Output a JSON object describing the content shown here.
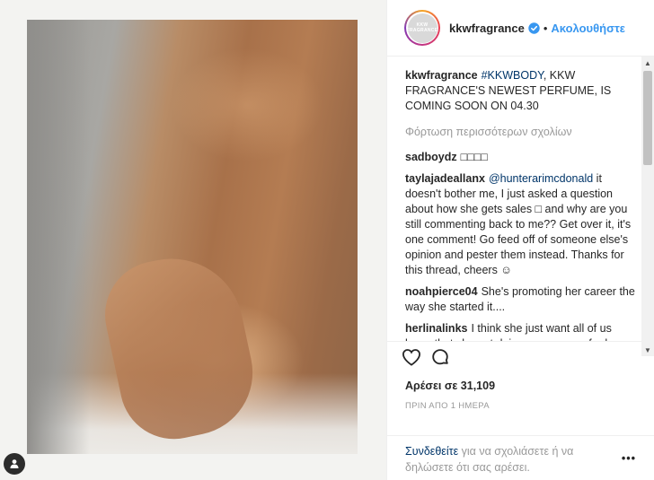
{
  "header": {
    "avatar_text": "KKW FRAGRANCE",
    "username": "kkwfragrance",
    "separator": "•",
    "follow_label": "Ακολουθήστε"
  },
  "caption": {
    "user": "kkwfragrance",
    "hashtag": "#KKWBODY",
    "text": ", KKW FRAGRANCE'S NEWEST PERFUME, IS COMING SOON ON 04.30"
  },
  "load_more": "Φόρτωση περισσότερων σχολίων",
  "comments": [
    {
      "user": "sadboydz",
      "pre": "",
      "mention": "",
      "text": "□□□□"
    },
    {
      "user": "taylajadeallanx",
      "pre": "",
      "mention": "@hunterarimcdonald",
      "text": " it doesn't bother me, I just asked a question about how she gets sales □ and why are you still commenting back to me?? Get over it, it's one comment! Go feed off of someone else's opinion and pester them instead. Thanks for this thread, cheers ☺"
    },
    {
      "user": "noahpierce04",
      "pre": "",
      "mention": "",
      "text": "She's promoting her career the way she started it...."
    },
    {
      "user": "herlinalinks",
      "pre": "",
      "mention": "",
      "text": "I think she just want all of us know that she not doing any surgery for her breast? Then what the poin this with the fragrance?"
    }
  ],
  "likes": "Αρέσει σε 31,109",
  "time": "ΠΡΙΝ ΑΠΟ 1 ΗΜΕΡΑ",
  "login": {
    "link": "Συνδεθείτε",
    "text": " για να σχολιάσετε ή να δηλώσετε ότι σας αρέσει."
  },
  "more_label": "•••",
  "icons": {
    "verified": "verified-badge-icon",
    "heart": "heart-icon",
    "comment": "comment-bubble-icon",
    "user_tag": "user-tag-icon"
  },
  "colors": {
    "link": "#3897f0",
    "dark_link": "#003569",
    "muted": "#999999"
  }
}
